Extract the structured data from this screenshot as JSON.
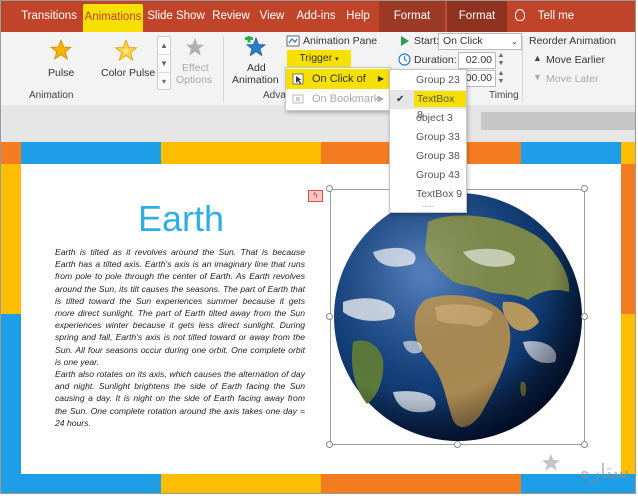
{
  "tabs": [
    {
      "label": "Transitions"
    },
    {
      "label": "Animations"
    },
    {
      "label": "Slide Show"
    },
    {
      "label": "Review"
    },
    {
      "label": "View"
    },
    {
      "label": "Add-ins"
    },
    {
      "label": "Help"
    },
    {
      "label": "Format"
    },
    {
      "label": "Format"
    },
    {
      "label": "Tell me"
    }
  ],
  "ribbon": {
    "animation_group": {
      "items": [
        "Pulse",
        "Color Pulse",
        "Effect",
        "Options"
      ],
      "label": "Animation"
    },
    "add_animation": [
      "Add",
      "Animation"
    ],
    "advanced_label": "Adva",
    "animation_pane": "Animation Pane",
    "trigger": "Trigger",
    "start_label": "Start:",
    "start_value": "On Click",
    "duration_label": "Duration:",
    "duration_value": "02.00",
    "delay_value": "00.00",
    "timing_label": "Timing",
    "reorder_title": "Reorder Animation",
    "move_earlier": "Move Earlier",
    "move_later": "Move Later"
  },
  "trigger_menu": {
    "items": [
      {
        "label": "On Click of"
      },
      {
        "label": "On Bookmark"
      }
    ]
  },
  "submenu": {
    "items": [
      {
        "label": "Group 23"
      },
      {
        "label": "TextBox 8"
      },
      {
        "label": "object 3"
      },
      {
        "label": "Group 33"
      },
      {
        "label": "Group 38"
      },
      {
        "label": "Group 43"
      },
      {
        "label": "TextBox 9"
      }
    ],
    "more": "....."
  },
  "slide": {
    "title": "Earth",
    "paragraph1": "Earth is tilted as it revolves around the Sun. That is because Earth has a tilted axis. Earth's axis is an  imaginary line that runs from pole to pole through the center of Earth. As Earth revolves around the  Sun, its tilt causes the seasons. The part of Earth that is tilted toward the Sun experiences summer because it gets more direct sunlight. The part of Earth tilted away from the Sun experiences winter  because it gets less direct sunlight. During spring and fall, Earth's axis is not tilted toward or away from  the Sun. All four seasons occur during one orbit. One complete orbit is one year.",
    "paragraph2": "Earth also rotates on its axis, which causes the alternation of day and night. Sunlight brightens the side of Earth facing the Sun causing a day. It is night on the side of Earth facing away from the Sun. One  complete rotation around the axis takes one day = 24 hours."
  },
  "colors": {
    "tab_bar": "#c0442a",
    "highlight": "#f6e000",
    "title_blue": "#2eaee3",
    "stripe_blue": "#1e9ee6",
    "stripe_yellow": "#ffbd00",
    "stripe_orange": "#f47c20"
  },
  "watermark": "ستاره"
}
